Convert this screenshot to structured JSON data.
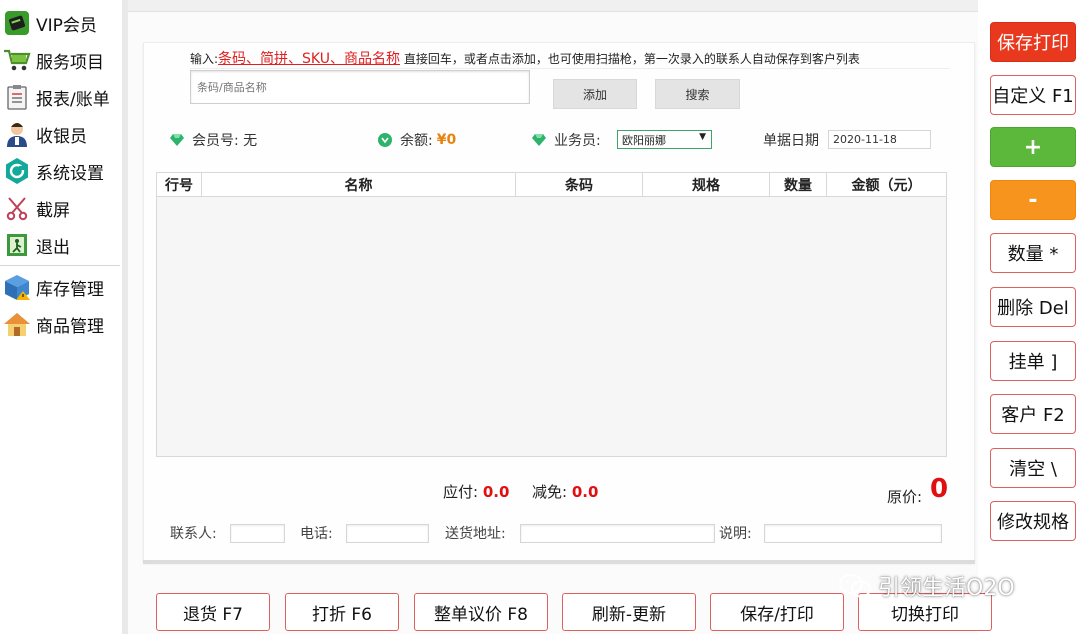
{
  "sidebar": {
    "items": [
      {
        "label": "VIP会员",
        "icon": "vip-card-icon"
      },
      {
        "label": "服务项目",
        "icon": "cart-icon"
      },
      {
        "label": "报表/账单",
        "icon": "clipboard-icon"
      },
      {
        "label": "收银员",
        "icon": "cashier-icon"
      },
      {
        "label": "系统设置",
        "icon": "settings-icon"
      },
      {
        "label": "截屏",
        "icon": "scissors-icon"
      },
      {
        "label": "退出",
        "icon": "exit-icon"
      },
      {
        "label": "库存管理",
        "icon": "inventory-box-icon"
      },
      {
        "label": "商品管理",
        "icon": "home-icon"
      }
    ]
  },
  "entry": {
    "hint_prefix": "输入:",
    "hint_keys": "条码、简拼、SKU、商品名称",
    "hint_suffix": " 直接回车，或者点击添加，也可使用扫描枪，第一次录入的联系人自动保存到客户列表",
    "barcode_placeholder": "条码/商品名称",
    "add_label": "添加",
    "search_label": "搜索"
  },
  "info": {
    "member_label": "会员号:",
    "member_value": "无",
    "balance_label": "余额:",
    "balance_value": "¥0",
    "staff_label": "业务员:",
    "staff_value": "欧阳丽娜",
    "date_label": "单据日期",
    "date_value": "2020-11-18"
  },
  "table": {
    "columns": [
      "行号",
      "名称",
      "条码",
      "规格",
      "数量",
      "金额（元）"
    ],
    "rows": []
  },
  "totals": {
    "payable_label": "应付:",
    "payable_value": "0.0",
    "discount_label": "减免:",
    "discount_value": "0.0",
    "original_label": "原价:",
    "original_value": "0"
  },
  "contact": {
    "contact_label": "联系人:",
    "phone_label": "电话:",
    "address_label": "送货地址:",
    "note_label": "说明:"
  },
  "bottom_buttons": [
    "退货 F7",
    "打折 F6",
    "整单议价 F8",
    "刷新-更新",
    "保存/打印",
    "切换打印"
  ],
  "right_buttons": [
    {
      "label": "保存打印",
      "style": "red"
    },
    {
      "label": "自定义 F1",
      "style": "outline"
    },
    {
      "label": "+",
      "style": "green"
    },
    {
      "label": "-",
      "style": "orange"
    },
    {
      "label": "数量 *",
      "style": "outline"
    },
    {
      "label": "删除 Del",
      "style": "outline"
    },
    {
      "label": "挂单 ]",
      "style": "outline"
    },
    {
      "label": "客户 F2",
      "style": "outline"
    },
    {
      "label": "清空 \\",
      "style": "outline"
    },
    {
      "label": "修改规格",
      "style": "outline"
    }
  ],
  "watermark": {
    "text": "引领生活O2O",
    "icon": "wechat-icon"
  },
  "colors": {
    "accent_red": "#e8391f",
    "green": "#5cb83a",
    "orange": "#f7941d",
    "amount_red": "#e01010"
  }
}
